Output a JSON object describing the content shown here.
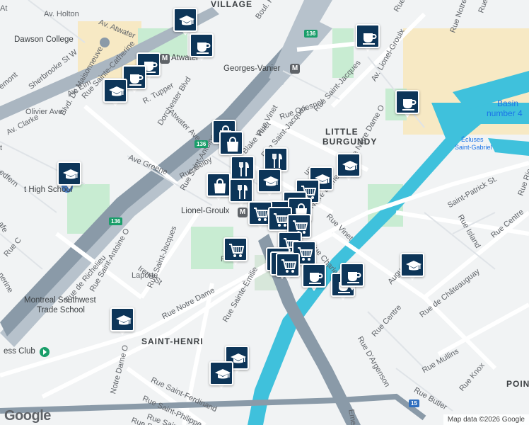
{
  "map": {
    "attribution": "Map data ©2026 Google",
    "logo": "Google",
    "colors": {
      "water": "#3fc1dc",
      "park": "#c8ecd2",
      "highway": "#8a9aa8",
      "marker": "#0d3558"
    }
  },
  "labels": [
    {
      "id": "village",
      "text": "VILLAGE",
      "kind": "dist"
    },
    {
      "id": "little-burgundy-1",
      "text": "LITTLE",
      "kind": "dist"
    },
    {
      "id": "little-burgundy-2",
      "text": "BURGUNDY",
      "kind": "dist"
    },
    {
      "id": "saint-henri",
      "text": "SAINT-HENRI",
      "kind": "dist"
    },
    {
      "id": "poin",
      "text": "POIN",
      "kind": "dist"
    },
    {
      "id": "basin-1",
      "text": "Basin",
      "kind": "water"
    },
    {
      "id": "basin-2",
      "text": "number 4",
      "kind": "water"
    },
    {
      "id": "ecluses-1",
      "text": "Écluses",
      "kind": "small-water"
    },
    {
      "id": "ecluses-2",
      "text": "Saint-Gabriel",
      "kind": "small-water"
    },
    {
      "id": "dawson",
      "text": "Dawson College",
      "kind": "poi"
    },
    {
      "id": "atwater",
      "text": "Atwater",
      "kind": "poi"
    },
    {
      "id": "georges-vanier",
      "text": "Georges-Vanier",
      "kind": "poi"
    },
    {
      "id": "lionel-groulx",
      "text": "Lionel-Groulx",
      "kind": "poi"
    },
    {
      "id": "high-school",
      "text": "t High School",
      "kind": "poi"
    },
    {
      "id": "trade-1",
      "text": "Montreal Southwest",
      "kind": "poi"
    },
    {
      "id": "trade-2",
      "text": "Trade School",
      "kind": "poi"
    },
    {
      "id": "ess-club",
      "text": "ess Club",
      "kind": "poi"
    },
    {
      "id": "av-holton",
      "text": "Av. Holton",
      "kind": "street"
    },
    {
      "id": "sherbrooke",
      "text": "Sherbrooke St W",
      "kind": "street"
    },
    {
      "id": "av-atwater",
      "text": "Av. Atwater",
      "kind": "street"
    },
    {
      "id": "av-elm",
      "text": "Av. Elm",
      "kind": "street"
    },
    {
      "id": "olivier",
      "text": "Olivier Ave",
      "kind": "street"
    },
    {
      "id": "av-clarke",
      "text": "Av. Clarke",
      "kind": "street"
    },
    {
      "id": "de-maisonneuve",
      "text": "Blvd. De Maisonneuve",
      "kind": "street"
    },
    {
      "id": "sainte-catherine",
      "text": "Rue Sainte-Catherine",
      "kind": "street"
    },
    {
      "id": "r-tupper",
      "text": "R. Tupper",
      "kind": "street"
    },
    {
      "id": "dorchester",
      "text": "Dorchester Blvd",
      "kind": "street"
    },
    {
      "id": "atwater-ave",
      "text": "Atwater Ave",
      "kind": "street"
    },
    {
      "id": "ave-greene",
      "text": "Ave Greene",
      "kind": "street"
    },
    {
      "id": "rue-selby",
      "text": "Rue Selby",
      "kind": "street"
    },
    {
      "id": "saint-antoine-1",
      "text": "Rue Saint-Antoine O",
      "kind": "street"
    },
    {
      "id": "saint-antoine-2",
      "text": "Rue Saint-Antoine O",
      "kind": "street"
    },
    {
      "id": "boul-rene",
      "text": "Boul. René-L",
      "kind": "street"
    },
    {
      "id": "rue-quesnel",
      "text": "Rue Quesnel",
      "kind": "street"
    },
    {
      "id": "rue-vinet",
      "text": "Rue Vinet",
      "kind": "street"
    },
    {
      "id": "rue-vinet-2",
      "text": "Rue Vinet",
      "kind": "street"
    },
    {
      "id": "blake-vinet",
      "text": "Blake Vinet",
      "kind": "street"
    },
    {
      "id": "saint-jacques-1",
      "text": "Rue Saint-Jacques",
      "kind": "street"
    },
    {
      "id": "saint-jacques-2",
      "text": "Rue Saint-Jacques",
      "kind": "street"
    },
    {
      "id": "saint-jacques-3",
      "text": "Rue Saint-Jacques",
      "kind": "street"
    },
    {
      "id": "saint-jacques-4",
      "text": "Rue Saint-",
      "kind": "street"
    },
    {
      "id": "lionel-groulx-av",
      "text": "Av. Lionel-Groulx",
      "kind": "street"
    },
    {
      "id": "notre-dame-1",
      "text": "Rue Notre Dame",
      "kind": "street"
    },
    {
      "id": "notre-dame-2",
      "text": "Rue Notre Dame O",
      "kind": "street"
    },
    {
      "id": "notre-dame-3",
      "text": "Rue Notre Dame",
      "kind": "street"
    },
    {
      "id": "notre-dame-4",
      "text": "Rue Notre Dame O",
      "kind": "street"
    },
    {
      "id": "rue-ba",
      "text": "Rue Ba",
      "kind": "street"
    },
    {
      "id": "saint-patrick",
      "text": "Saint-Patrick St.",
      "kind": "street"
    },
    {
      "id": "rue-charlevoix",
      "text": "Rue Charlev",
      "kind": "street"
    },
    {
      "id": "irene",
      "text": "Irene St",
      "kind": "street"
    },
    {
      "id": "laporte",
      "text": "Laporte",
      "kind": "street"
    },
    {
      "id": "richelieu",
      "text": "Rue de Richelieu",
      "kind": "street"
    },
    {
      "id": "rue-island",
      "text": "Rue Island",
      "kind": "street"
    },
    {
      "id": "rue-centre-1",
      "text": "Rue Centre",
      "kind": "street"
    },
    {
      "id": "rue-centre-2",
      "text": "Rue Centre",
      "kind": "street"
    },
    {
      "id": "rue-ric",
      "text": "Rue Ric",
      "kind": "street"
    },
    {
      "id": "chateauguay",
      "text": "Rue de Châteauguay",
      "kind": "street"
    },
    {
      "id": "augustin",
      "text": "Augu        in St",
      "kind": "street"
    },
    {
      "id": "dargenson",
      "text": "Rue D'Argenson",
      "kind": "street"
    },
    {
      "id": "mullins",
      "text": "Rue Mullins",
      "kind": "street"
    },
    {
      "id": "butler",
      "text": "Rue Butler",
      "kind": "street"
    },
    {
      "id": "knox",
      "text": "Rue Knox",
      "kind": "street"
    },
    {
      "id": "sainte-emilie",
      "text": "Rue Sainte-Émilie",
      "kind": "street"
    },
    {
      "id": "saint-ferdinand",
      "text": "Rue Saint-Ferdinand",
      "kind": "street"
    },
    {
      "id": "saint-philippe",
      "text": "Rue Saint-Philippe",
      "kind": "street"
    },
    {
      "id": "sainte-marg",
      "text": "Rue Sainte-Marg",
      "kind": "street"
    },
    {
      "id": "rue-beaud",
      "text": "Rue Beaud",
      "kind": "street"
    },
    {
      "id": "notre-dame-o-5",
      "text": "Notre Dame O",
      "kind": "street"
    },
    {
      "id": "eme-rien",
      "text": "Eme",
      "kind": "street"
    },
    {
      "id": "lemont",
      "text": "emont",
      "kind": "street"
    },
    {
      "id": "nerine",
      "text": "nerine",
      "kind": "street"
    },
    {
      "id": "fe",
      "text": "afe",
      "kind": "street"
    },
    {
      "id": "edfern",
      "text": "edfern",
      "kind": "street"
    },
    {
      "id": "rue-c",
      "text": "Rue C",
      "kind": "street"
    },
    {
      "id": "ruelle",
      "text": "Ru   an",
      "kind": "street"
    },
    {
      "id": "ux",
      "text": "ux",
      "kind": "street"
    },
    {
      "id": "at-west",
      "text": "At",
      "kind": "street"
    },
    {
      "id": "t-edge",
      "text": "t",
      "kind": "street"
    }
  ],
  "metro_symbol": "M",
  "highway_shields": [
    "136",
    "136",
    "136",
    "15"
  ],
  "markers": [
    {
      "type": "school"
    },
    {
      "type": "coffee"
    },
    {
      "type": "coffee"
    },
    {
      "type": "coffee"
    },
    {
      "type": "coffee"
    },
    {
      "type": "school"
    },
    {
      "type": "coffee"
    },
    {
      "type": "shopping"
    },
    {
      "type": "shopping"
    },
    {
      "type": "restaurant"
    },
    {
      "type": "restaurant"
    },
    {
      "type": "shopping"
    },
    {
      "type": "restaurant"
    },
    {
      "type": "school"
    },
    {
      "type": "school"
    },
    {
      "type": "school"
    },
    {
      "type": "grocery"
    },
    {
      "type": "grocery"
    },
    {
      "type": "grocery"
    },
    {
      "type": "shopping"
    },
    {
      "type": "grocery"
    },
    {
      "type": "grocery"
    },
    {
      "type": "grocery"
    },
    {
      "type": "grocery"
    },
    {
      "type": "grocery"
    },
    {
      "type": "grocery"
    },
    {
      "type": "grocery"
    },
    {
      "type": "grocery"
    },
    {
      "type": "grocery"
    },
    {
      "type": "coffee"
    },
    {
      "type": "coffee"
    },
    {
      "type": "coffee"
    },
    {
      "type": "school"
    },
    {
      "type": "school"
    },
    {
      "type": "school"
    },
    {
      "type": "school"
    },
    {
      "type": "school"
    }
  ]
}
